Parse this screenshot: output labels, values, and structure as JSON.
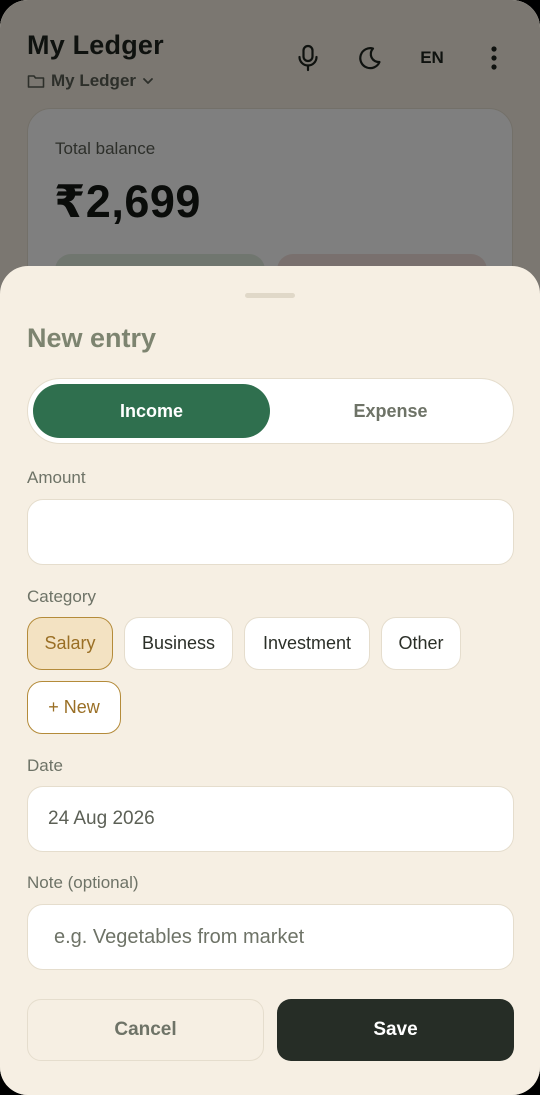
{
  "app": {
    "title": "My Ledger",
    "ledger_name": "My Ledger",
    "language": "EN"
  },
  "balance": {
    "label": "Total balance",
    "value": "₹2,699"
  },
  "sheet": {
    "title": "New entry",
    "tabs": {
      "income": "Income",
      "expense": "Expense",
      "active": "income"
    },
    "amount": {
      "label": "Amount",
      "value": ""
    },
    "category": {
      "label": "Category",
      "chips": [
        "Salary",
        "Business",
        "Investment",
        "Other"
      ],
      "selected": "Salary",
      "new_label": "+ New"
    },
    "date": {
      "label": "Date",
      "value": "24 Aug 2026"
    },
    "note": {
      "label": "Note (optional)",
      "placeholder": "e.g. Vegetables from market"
    },
    "cancel_label": "Cancel",
    "save_label": "Save"
  },
  "colors": {
    "accent_green": "#2f6f4e",
    "accent_gold": "#b48b3a",
    "sheet_bg": "#f6efe3",
    "save_bg": "#262d26"
  },
  "icons": [
    "folder-icon",
    "chevron-down-icon",
    "mic-icon",
    "moon-icon",
    "more-vertical-icon"
  ]
}
